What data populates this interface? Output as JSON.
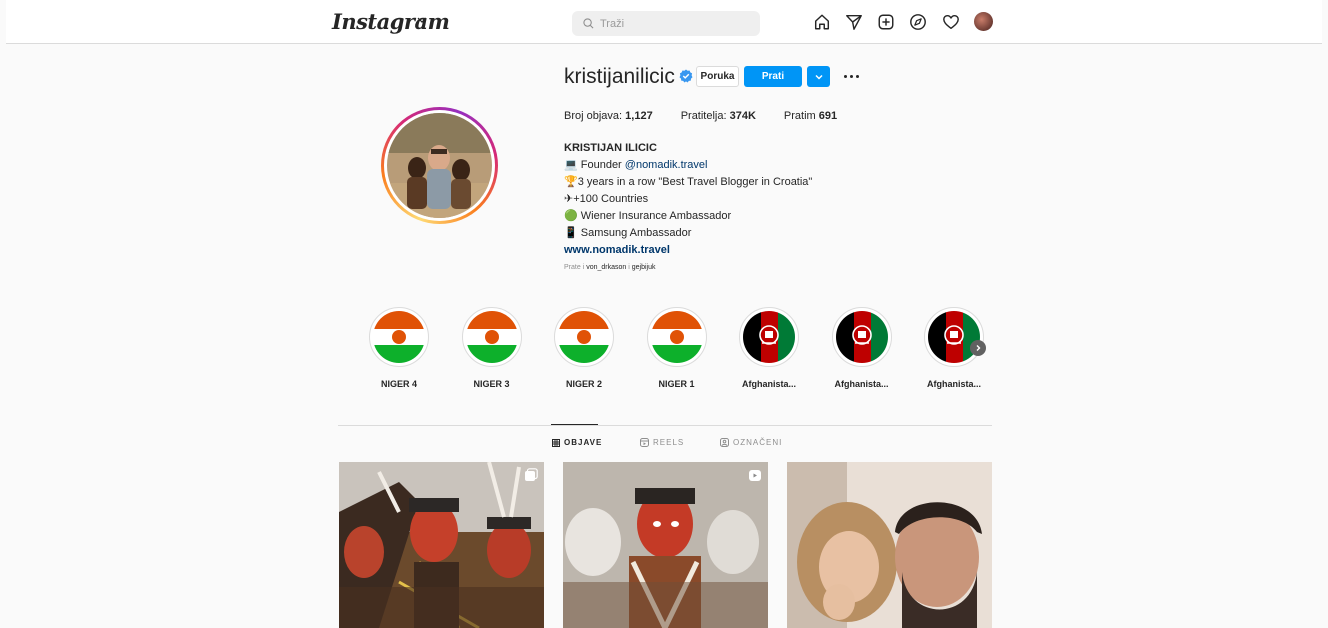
{
  "header": {
    "logo_text": "Instagram",
    "search_placeholder": "Traži",
    "nav_icons": [
      "home-icon",
      "send-icon",
      "new-post-icon",
      "explore-icon",
      "heart-icon",
      "profile-avatar"
    ]
  },
  "profile": {
    "username": "kristijanilicic",
    "verified": true,
    "message_label": "Poruka",
    "follow_label": "Prati",
    "stats": {
      "posts_label": "Broj objava:",
      "posts_value": "1,127",
      "followers_label": "Pratitelja:",
      "followers_value": "374K",
      "following_label": "Pratim",
      "following_value": "691"
    },
    "bio": {
      "name": "KRISTIJAN ILICIC",
      "line1_prefix": "💻 Founder ",
      "line1_link": "@nomadik.travel",
      "line2": "🏆3 years in a row \"Best Travel Blogger in Croatia\"",
      "line3": "✈+100 Countries",
      "line4": "🟢 Wiener Insurance Ambassador",
      "line5": "📱 Samsung Ambassador",
      "website": "www.nomadik.travel"
    },
    "followed_by_prefix": "Prate i ",
    "followed_by_user1": "von_drkason",
    "followed_by_sep": " i ",
    "followed_by_user2": "gejbijuk"
  },
  "highlights": [
    {
      "label": "NIGER 4",
      "flag": "niger"
    },
    {
      "label": "NIGER 3",
      "flag": "niger"
    },
    {
      "label": "NIGER 2",
      "flag": "niger"
    },
    {
      "label": "NIGER 1",
      "flag": "niger"
    },
    {
      "label": "Afghanista...",
      "flag": "afghanistan"
    },
    {
      "label": "Afghanista...",
      "flag": "afghanistan"
    },
    {
      "label": "Afghanista...",
      "flag": "afghanistan"
    }
  ],
  "tabs": [
    {
      "label": "OBJAVE",
      "active": true
    },
    {
      "label": "REELS",
      "active": false
    },
    {
      "label": "OZNAČENI",
      "active": false
    }
  ],
  "posts": [
    {
      "type": "carousel",
      "badge_icon": "carousel-icon"
    },
    {
      "type": "reel",
      "badge_icon": "reel-icon"
    },
    {
      "type": "image",
      "badge_icon": ""
    }
  ],
  "colors": {
    "accent": "#0095f6",
    "link": "#00376b",
    "border": "#dbdbdb",
    "background": "#fafafa"
  }
}
